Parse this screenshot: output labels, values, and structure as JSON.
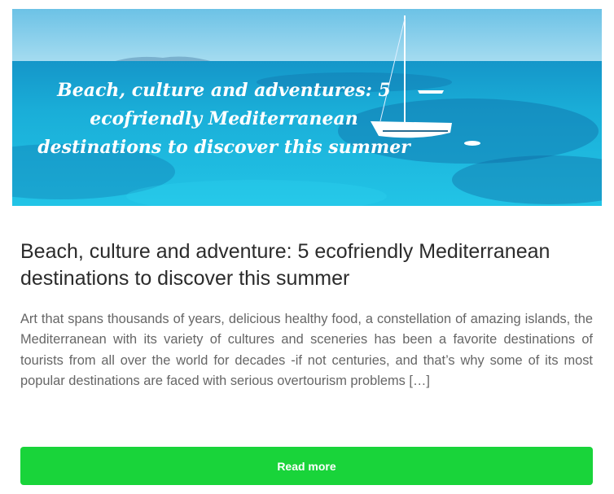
{
  "post": {
    "hero_image": {
      "caption_lines": [
        "Beach, culture and adventures: 5",
        "ecofriendly Mediterranean",
        "destinations to discover this summer"
      ],
      "alt": "Sailboat on turquoise Mediterranean sea"
    },
    "title": "Beach, culture and adventure: 5 ecofriendly Mediterranean destinations to discover this summer",
    "excerpt": "Art that spans thousands of years, delicious healthy food, a constellation of amazing islands, the Mediterranean with its variety of cultures and sceneries has been a favorite destinations of tourists from all over the world for decades -if not centuries, and that’s why some of its most popular destinations are faced with serious overtourism problems […]",
    "read_more_label": "Read more"
  },
  "colors": {
    "button": "#19d43a",
    "title": "#2b2b2b",
    "excerpt": "#666666",
    "sea": "#1cb6d9"
  }
}
